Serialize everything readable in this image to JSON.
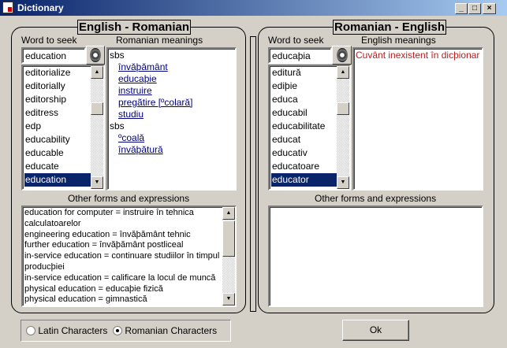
{
  "window": {
    "title": "Dictionary",
    "minimize": "_",
    "maximize": "□",
    "close": "×"
  },
  "en_ro": {
    "title": "English - Romanian",
    "word_label": "Word to seek",
    "word_value": "education",
    "meanings_label": "Romanian meanings",
    "meanings": [
      {
        "type": "pos",
        "text": "sbs"
      },
      {
        "type": "link",
        "text": "învăþământ"
      },
      {
        "type": "link",
        "text": "educaþie"
      },
      {
        "type": "link",
        "text": "instruire"
      },
      {
        "type": "link",
        "text": "pregãtire  [ºcolară]"
      },
      {
        "type": "link",
        "text": "studiu"
      },
      {
        "type": "pos",
        "text": "sbs"
      },
      {
        "type": "link",
        "text": "ºcoală"
      },
      {
        "type": "link",
        "text": "învăþătură"
      }
    ],
    "words": [
      "editorialize",
      "editorially",
      "editorship",
      "editress",
      "edp",
      "educability",
      "educable",
      "educate",
      "education"
    ],
    "selected_index": 8,
    "other_label": "Other forms and expressions",
    "other": [
      "education for computer =  instruire  în tehnica calculatoarelor",
      "engineering education =  învăþământ  tehnic",
      "further education =  învăþământ  postliceal",
      "in-service education =  continuare  studiilor în timpul producþiei",
      "in-service education =  calificare  la locul de muncă",
      "physical education =  educaþie  fizică",
      "physical education =  gimnastică"
    ]
  },
  "ro_en": {
    "title": "Romanian - English",
    "word_label": "Word to seek",
    "word_value": "educaþia",
    "meanings_label": "English meanings",
    "meanings_error": "Cuvânt inexistent în dicþionar",
    "error_color": "#b22222",
    "words": [
      "editură",
      "ediþie",
      "educa",
      "educabil",
      "educabilitate",
      "educat",
      "educativ",
      "educatoare",
      "educator"
    ],
    "selected_index": 8,
    "other_label": "Other forms and expressions"
  },
  "options": {
    "latin": "Latin Characters",
    "romanian": "Romanian Characters",
    "selected": "romanian"
  },
  "ok_label": "Ok"
}
